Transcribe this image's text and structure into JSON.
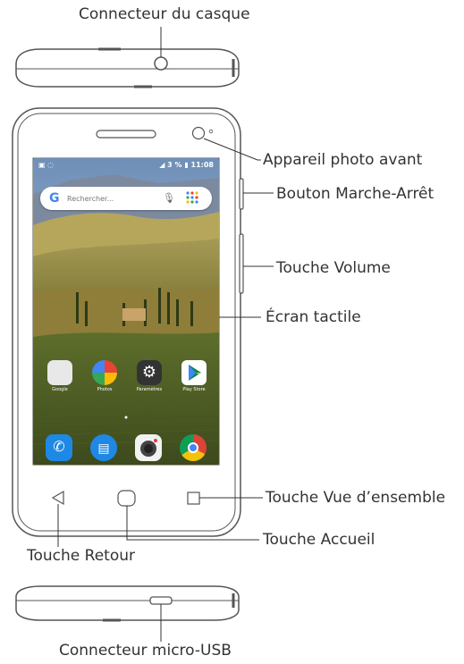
{
  "labels": {
    "headphone": "Connecteur du casque",
    "front_camera": "Appareil photo avant",
    "power_button": "Bouton Marche-Arrêt",
    "volume": "Touche Volume",
    "touchscreen": "Écran tactile",
    "overview": "Touche Vue d’ensemble",
    "home": "Touche Accueil",
    "back": "Touche Retour",
    "usb": "Connecteur micro-USB"
  },
  "screen": {
    "status_battery": "3 %",
    "status_time": "11:08",
    "search_placeholder": "Rechercher...",
    "apps": [
      "Google",
      "Photos",
      "Paramètres",
      "Play Store"
    ]
  },
  "colors": {
    "outline": "#555555",
    "leader": "#333333",
    "sky": "#8fb4d9",
    "field": "#9a8a3c"
  }
}
